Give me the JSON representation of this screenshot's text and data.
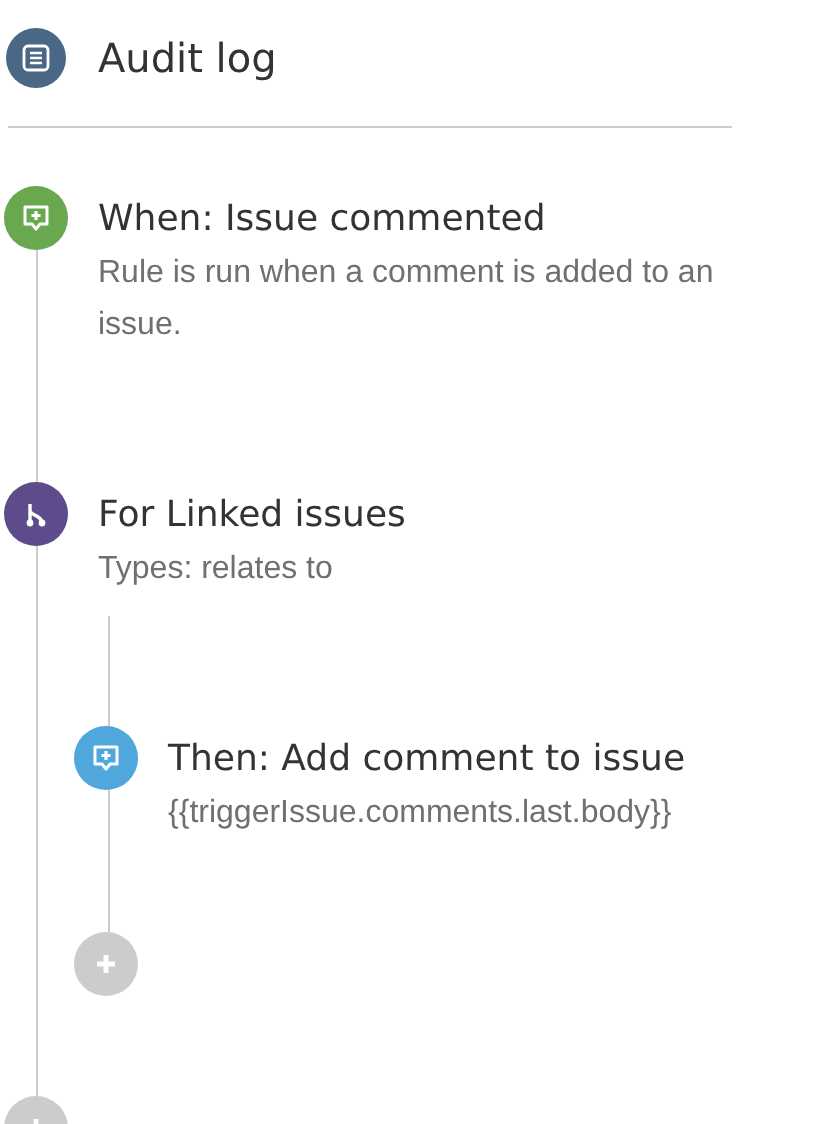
{
  "header": {
    "title": "Audit log"
  },
  "steps": [
    {
      "kind": "trigger",
      "title": "When: Issue commented",
      "description": "Rule is run when a comment is added to an issue."
    },
    {
      "kind": "branch",
      "title": "For Linked issues",
      "description": "Types: relates to",
      "children": [
        {
          "kind": "action",
          "title": "Then: Add comment to issue",
          "description": "{{triggerIssue.comments.last.body}}"
        },
        {
          "kind": "add"
        }
      ]
    },
    {
      "kind": "add"
    }
  ]
}
